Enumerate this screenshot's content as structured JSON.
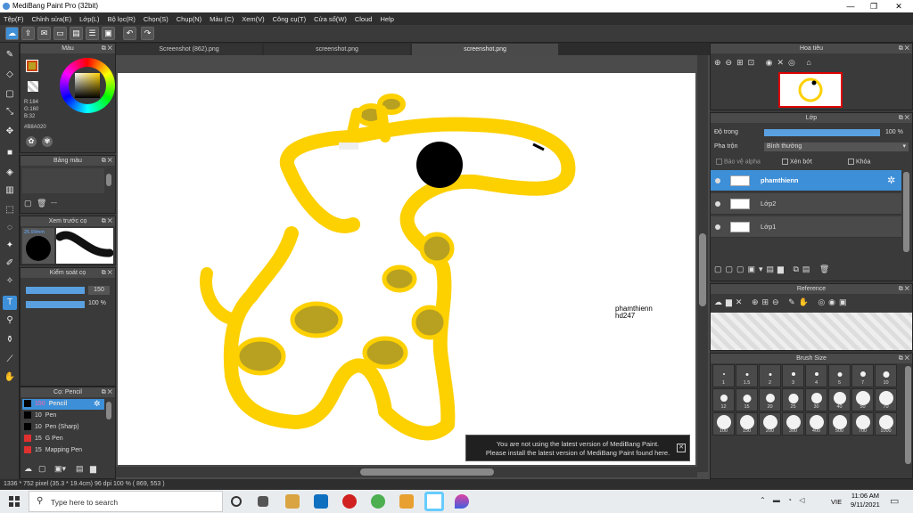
{
  "window": {
    "title": "MediBang Paint Pro (32bit)"
  },
  "menu": [
    "Tệp(F)",
    "Chỉnh sửa(E)",
    "Lớp(L)",
    "Bộ lọc(R)",
    "Chọn(S)",
    "Chụp(N)",
    "Màu (C)",
    "Xem(V)",
    "Công cụ(T)",
    "Cửa sổ(W)",
    "Cloud",
    "Help"
  ],
  "tabs": [
    "Screenshot (862).png",
    "screenshot.png",
    "screenshot.png"
  ],
  "color_panel": {
    "title": "Màu",
    "rgb": [
      "R:184",
      "G:160",
      "B:32"
    ],
    "hex": "#B8A020",
    "main_color": "#b8a020",
    "sub_color": "#cc4400"
  },
  "swatch_panel": {
    "title": "Bảng màu",
    "dash": "---"
  },
  "brush_preview": {
    "title": "Xem trước cọ",
    "size": "25.99mm"
  },
  "brush_control": {
    "title": "Kiểm soát cọ",
    "size_value": "150",
    "opacity_value": "100 %"
  },
  "brush_list": {
    "title": "Cọ: Pencil",
    "items": [
      {
        "size": "150",
        "name": "Pencil",
        "color": "#000000",
        "selected": true
      },
      {
        "size": "10",
        "name": "Pen",
        "color": "#000000"
      },
      {
        "size": "10",
        "name": "Pen (Sharp)",
        "color": "#000000"
      },
      {
        "size": "15",
        "name": "G Pen",
        "color": "#e03030"
      },
      {
        "size": "15",
        "name": "Mapping Pen",
        "color": "#e03030"
      }
    ]
  },
  "navigator": {
    "title": "Hoa tiêu"
  },
  "layer_panel": {
    "title": "Lớp",
    "opacity_label": "Độ trong",
    "opacity_value": "100 %",
    "blend_label": "Pha trộn",
    "blend_value": "Bình thường",
    "protect_alpha": "Bảo vệ alpha",
    "clipping": "Xén bớt",
    "lock": "Khóa",
    "layers": [
      {
        "name": "phamthienn",
        "selected": true
      },
      {
        "name": "Lớp2",
        "selected": false
      },
      {
        "name": "Lớp1",
        "selected": false
      }
    ]
  },
  "reference_panel": {
    "title": "Reference"
  },
  "brush_size_panel": {
    "title": "Brush Size",
    "sizes": [
      "1",
      "1.5",
      "2",
      "3",
      "4",
      "5",
      "7",
      "10",
      "12",
      "15",
      "20",
      "25",
      "30",
      "40",
      "50",
      "70",
      "100",
      "150",
      "200",
      "300",
      "400",
      "500",
      "700",
      "1000"
    ]
  },
  "canvas_text": [
    "phamthienn",
    "hd247"
  ],
  "notification": {
    "line1": "You are not using the latest version of MediBang Paint.",
    "line2": "Please install the latest version of MediBang Paint found here."
  },
  "status": "1336 * 752 pixel  (35.3 * 19.4cm)  96 dpi  100 %  ( 869, 553 )",
  "taskbar": {
    "search_placeholder": "Type here to search",
    "lang": "VIE",
    "time": "11:06 AM",
    "date": "9/11/2021"
  },
  "colors": {
    "accent": "#3d8fd8",
    "giraffe_yellow": "#fdd000",
    "spot": "#b8a020"
  }
}
